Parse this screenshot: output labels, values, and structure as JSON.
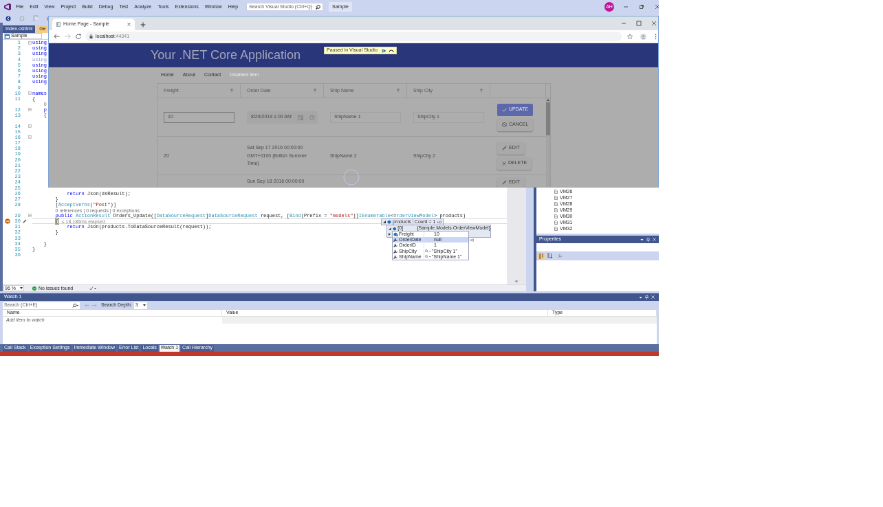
{
  "vs": {
    "menu": [
      "File",
      "Edit",
      "View",
      "Project",
      "Build",
      "Debug",
      "Test",
      "Analyze",
      "Tools",
      "Extensions",
      "Window",
      "Help"
    ],
    "search": {
      "placeholder": "Search Visual Studio (Ctrl+Q)"
    },
    "solution_name": "Sample",
    "account": "AH",
    "document_tabs": [
      {
        "label": "Index.cshtml",
        "selected": false
      },
      {
        "label": "Ge",
        "selected": true
      }
    ],
    "nav_dropdown": "Sample",
    "code": [
      {
        "kind": "code",
        "number": "1",
        "fold": true,
        "current": false,
        "tokens": [
          {
            "text": "using",
            "kind": "kw"
          }
        ]
      },
      {
        "kind": "code",
        "number": "2",
        "fold": false,
        "current": false,
        "tokens": [
          {
            "text": "using",
            "kind": "kw"
          }
        ]
      },
      {
        "kind": "code",
        "number": "3",
        "fold": false,
        "current": false,
        "tokens": [
          {
            "text": "using",
            "kind": "kw"
          }
        ]
      },
      {
        "kind": "code",
        "number": "4",
        "fold": false,
        "current": false,
        "tokens": [
          {
            "text": "using",
            "kind": "unused"
          }
        ]
      },
      {
        "kind": "code",
        "number": "5",
        "fold": false,
        "current": false,
        "tokens": [
          {
            "text": "using",
            "kind": "kw"
          }
        ]
      },
      {
        "kind": "code",
        "number": "6",
        "fold": false,
        "current": false,
        "tokens": [
          {
            "text": "using",
            "kind": "kw"
          }
        ]
      },
      {
        "kind": "code",
        "number": "7",
        "fold": false,
        "current": false,
        "tokens": [
          {
            "text": "using",
            "kind": "kw"
          }
        ]
      },
      {
        "kind": "code",
        "number": "8",
        "fold": false,
        "current": false,
        "tokens": [
          {
            "text": "using",
            "kind": "kw"
          }
        ]
      },
      {
        "kind": "code",
        "number": "9",
        "fold": false,
        "current": false
      },
      {
        "kind": "code",
        "number": "10",
        "fold": true,
        "current": false,
        "tokens": [
          {
            "text": "names",
            "kind": "kw"
          }
        ]
      },
      {
        "kind": "code",
        "number": "11",
        "fold": false,
        "current": false,
        "tokens": [
          {
            "text": "{",
            "kind": "plain"
          }
        ]
      },
      {
        "kind": "lens",
        "text": "0"
      },
      {
        "kind": "code",
        "number": "12",
        "fold": true,
        "current": false,
        "tokens": [
          {
            "text": "    p",
            "kind": "kw"
          }
        ]
      },
      {
        "kind": "code",
        "number": "13",
        "fold": false,
        "current": false,
        "tokens": [
          {
            "text": "    {",
            "kind": "plain"
          }
        ]
      },
      {
        "kind": "lens"
      },
      {
        "kind": "code",
        "number": "14",
        "fold": true,
        "current": false
      },
      {
        "kind": "code",
        "number": "15",
        "fold": false,
        "current": false
      },
      {
        "kind": "code",
        "number": "16",
        "fold": true,
        "current": false
      },
      {
        "kind": "code",
        "number": "17",
        "fold": false,
        "current": false
      },
      {
        "kind": "code",
        "number": "18",
        "fold": false,
        "current": false
      },
      {
        "kind": "code",
        "number": "19",
        "fold": false,
        "current": false
      },
      {
        "kind": "code",
        "number": "20",
        "fold": false,
        "current": false
      },
      {
        "kind": "code",
        "number": "21",
        "fold": false,
        "current": false
      },
      {
        "kind": "code",
        "number": "22",
        "fold": false,
        "current": false
      },
      {
        "kind": "code",
        "number": "23",
        "fold": false,
        "current": false
      },
      {
        "kind": "code",
        "number": "24",
        "fold": false,
        "current": false
      },
      {
        "kind": "code",
        "number": "25",
        "fold": false,
        "current": false
      },
      {
        "kind": "code",
        "number": "26",
        "fold": false,
        "current": false,
        "tokens": [
          {
            "text": "            return",
            "kind": "kw"
          },
          {
            "text": " Json(dsResult);",
            "kind": "plain"
          }
        ]
      },
      {
        "kind": "code",
        "number": "27",
        "fold": false,
        "current": false,
        "tokens": [
          {
            "text": "        }",
            "kind": "plain"
          }
        ]
      },
      {
        "kind": "code",
        "number": "28",
        "fold": false,
        "current": false,
        "tokens": [
          {
            "text": "        [",
            "kind": "plain"
          },
          {
            "text": "AcceptVerbs",
            "kind": "type"
          },
          {
            "text": "(",
            "kind": "plain"
          },
          {
            "text": "\"Post\"",
            "kind": "str"
          },
          {
            "text": ")]",
            "kind": "plain"
          }
        ]
      },
      {
        "kind": "lens",
        "text": "0 references | 0 requests | 0 exceptions"
      },
      {
        "kind": "code",
        "number": "29",
        "fold": true,
        "current": false,
        "tokens": [
          {
            "text": "        public",
            "kind": "kw"
          },
          {
            "text": " ActionResult",
            "kind": "type"
          },
          {
            "text": " Orders_Update([",
            "kind": "plain"
          },
          {
            "text": "DataSourceRequest",
            "kind": "type"
          },
          {
            "text": "]",
            "kind": "plain"
          },
          {
            "text": "DataSourceRequest",
            "kind": "type"
          },
          {
            "text": " request, [",
            "kind": "plain"
          },
          {
            "text": "Bind",
            "kind": "type"
          },
          {
            "text": "(Prefix = ",
            "kind": "plain"
          },
          {
            "text": "\"models\"",
            "kind": "str"
          },
          {
            "text": ")]",
            "kind": "plain"
          },
          {
            "text": "IEnumerable",
            "kind": "type"
          },
          {
            "text": "<",
            "kind": "plain"
          },
          {
            "text": "OrderViewModel",
            "kind": "type"
          },
          {
            "text": "> products)",
            "kind": "plain"
          }
        ]
      },
      {
        "kind": "code",
        "number": "30",
        "fold": false,
        "current": true,
        "tokens": [
          {
            "text": "        {",
            "kind": "match"
          }
        ],
        "tip": "≤ 18,186ms elapsed"
      },
      {
        "kind": "code",
        "number": "31",
        "fold": false,
        "current": false,
        "tokens": [
          {
            "text": "            return",
            "kind": "kw"
          },
          {
            "text": " Json(products.ToDataSourceResult(request));",
            "kind": "plain"
          }
        ]
      },
      {
        "kind": "code",
        "number": "32",
        "fold": false,
        "current": false,
        "tokens": [
          {
            "text": "        }",
            "kind": "plain"
          }
        ]
      },
      {
        "kind": "code",
        "number": "33",
        "fold": false,
        "current": false
      },
      {
        "kind": "code",
        "number": "34",
        "fold": false,
        "current": false,
        "tokens": [
          {
            "text": "    }",
            "kind": "plain"
          }
        ]
      },
      {
        "kind": "code",
        "number": "35",
        "fold": false,
        "current": false,
        "tokens": [
          {
            "text": "}",
            "kind": "plain"
          }
        ]
      },
      {
        "kind": "code",
        "number": "36",
        "fold": false,
        "current": false
      }
    ],
    "datatip": {
      "root": {
        "name": "products",
        "value": "Count = 1"
      },
      "item": {
        "name": "[0]",
        "value": "{Sample.Models.OrderViewModel}"
      },
      "members": [
        {
          "name": "Freight",
          "value": "10",
          "kind": "field",
          "selected": false,
          "viewer": false
        },
        {
          "name": "OrderDate",
          "value": "null",
          "kind": "property",
          "selected": true,
          "viewer": false
        },
        {
          "name": "OrderID",
          "value": "1",
          "kind": "property",
          "selected": false,
          "viewer": false
        },
        {
          "name": "ShipCity",
          "value": "\"ShipCity 1\"",
          "kind": "property",
          "selected": false,
          "viewer": true
        },
        {
          "name": "ShipName",
          "value": "\"ShipName 1\"",
          "kind": "property",
          "selected": false,
          "viewer": true
        }
      ]
    },
    "zoom": "96 %",
    "issues": "No issues found",
    "solution_items": [
      "VM26",
      "VM27",
      "VM28",
      "VM29",
      "VM30",
      "VM31",
      "VM32"
    ],
    "properties": {
      "title": "Properties"
    },
    "watch": {
      "title": "Watch 1",
      "search": {
        "placeholder": "Search (Ctrl+E)"
      },
      "depth_label": "Search Depth:",
      "depth": "3",
      "columns": [
        "Name",
        "Value",
        "Type"
      ],
      "add_hint": "Add item to watch"
    },
    "tool_tabs": [
      {
        "label": "Call Stack",
        "selected": false
      },
      {
        "label": "Exception Settings",
        "selected": false
      },
      {
        "label": "Immediate Window",
        "selected": false
      },
      {
        "label": "Error List",
        "selected": false
      },
      {
        "label": "Locals",
        "selected": false
      },
      {
        "label": "Watch 1",
        "selected": true
      },
      {
        "label": "Call Hierarchy",
        "selected": false
      }
    ]
  },
  "browser": {
    "tab": "Home Page - Sample",
    "url_host": "localhost",
    "url_port": ":44341",
    "page": {
      "brand": "Your .NET Core Application",
      "debug_badge": "Paused in Visual Studio",
      "nav": [
        {
          "label": "Home",
          "disabled": false
        },
        {
          "label": "About",
          "disabled": false
        },
        {
          "label": "Contact",
          "disabled": false
        },
        {
          "label": "Disabled item",
          "disabled": true
        }
      ],
      "grid": {
        "columns": [
          "Freight",
          "Order Date",
          "Ship Name",
          "Ship City"
        ],
        "rows": [
          {
            "kind": "edit",
            "cells": [
              "10",
              "8/29/2019 1:00 AM",
              "ShipName 1",
              "ShipCity 1"
            ],
            "actions": [
              {
                "label": "UPDATE",
                "kind": "update"
              },
              {
                "label": "CANCEL",
                "kind": "cancel"
              }
            ]
          },
          {
            "kind": "view",
            "cells": [
              "20",
              "Sat Sep 17 2016 00:00:00 GMT+0100 (British Summer Time)",
              "ShipName 2",
              "ShipCity 2"
            ],
            "actions": [
              {
                "label": "EDIT",
                "kind": "edit"
              },
              {
                "label": "DELETE",
                "kind": "delete"
              }
            ]
          },
          {
            "kind": "partial",
            "cells": [
              null,
              "Sun Sep 18 2016 00:00:00",
              null,
              null
            ],
            "actions": [
              {
                "label": "EDIT",
                "kind": "edit"
              }
            ]
          }
        ]
      }
    }
  }
}
